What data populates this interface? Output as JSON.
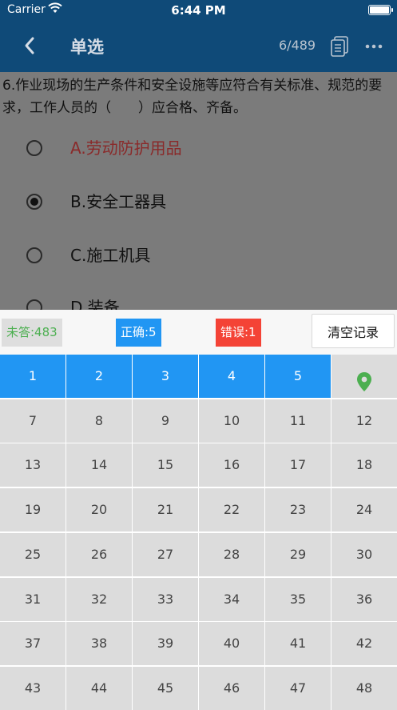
{
  "status_bar": {
    "carrier": "Carrier",
    "time": "6:44 PM"
  },
  "nav": {
    "title": "单选",
    "counter": "6/489"
  },
  "question": {
    "text": "6.作业现场的生产条件和安全设施等应符合有关标准、规范的要求，工作人员的（　　）应合格、齐备。",
    "options": [
      {
        "label": "A.劳动防护用品",
        "selected": false,
        "color": "red"
      },
      {
        "label": "B.安全工器具",
        "selected": true
      },
      {
        "label": "C.施工机具",
        "selected": false
      },
      {
        "label": "D.装备",
        "selected": false
      }
    ]
  },
  "answer_sheet": {
    "unanswered": "未答:483",
    "correct": "正确:5",
    "wrong": "错误:1",
    "clear_label": "清空记录",
    "colors": {
      "answered": "#2196f3",
      "correct_badge": "#2196f3",
      "wrong_badge": "#f44336",
      "unanswered_text": "#4caf50",
      "pin": "#4caf50"
    },
    "cells": [
      {
        "label": "1",
        "state": "answered"
      },
      {
        "label": "2",
        "state": "answered"
      },
      {
        "label": "3",
        "state": "answered"
      },
      {
        "label": "4",
        "state": "answered"
      },
      {
        "label": "5",
        "state": "answered"
      },
      {
        "label": "",
        "state": "current",
        "icon": "location-pin-icon"
      },
      {
        "label": "7"
      },
      {
        "label": "8"
      },
      {
        "label": "9"
      },
      {
        "label": "10"
      },
      {
        "label": "11"
      },
      {
        "label": "12"
      },
      {
        "label": "13"
      },
      {
        "label": "14"
      },
      {
        "label": "15"
      },
      {
        "label": "16"
      },
      {
        "label": "17"
      },
      {
        "label": "18"
      },
      {
        "label": "19"
      },
      {
        "label": "20"
      },
      {
        "label": "21"
      },
      {
        "label": "22"
      },
      {
        "label": "23"
      },
      {
        "label": "24"
      },
      {
        "label": "25"
      },
      {
        "label": "26"
      },
      {
        "label": "27"
      },
      {
        "label": "28"
      },
      {
        "label": "29"
      },
      {
        "label": "30"
      },
      {
        "label": "31"
      },
      {
        "label": "32"
      },
      {
        "label": "33"
      },
      {
        "label": "34"
      },
      {
        "label": "35"
      },
      {
        "label": "36"
      },
      {
        "label": "37"
      },
      {
        "label": "38"
      },
      {
        "label": "39"
      },
      {
        "label": "40"
      },
      {
        "label": "41"
      },
      {
        "label": "42"
      },
      {
        "label": "43"
      },
      {
        "label": "44"
      },
      {
        "label": "45"
      },
      {
        "label": "46"
      },
      {
        "label": "47"
      },
      {
        "label": "48"
      }
    ]
  }
}
